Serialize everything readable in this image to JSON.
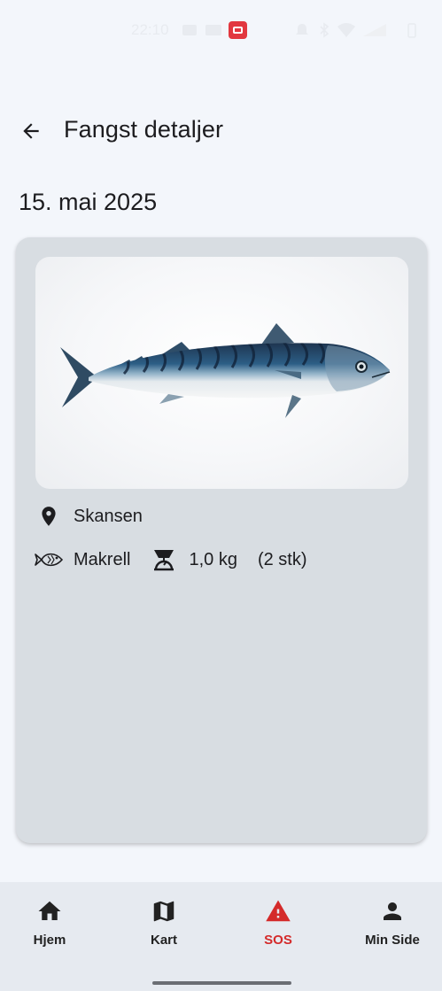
{
  "status_bar": {
    "time": "22:10"
  },
  "header": {
    "title": "Fangst detaljer"
  },
  "catch": {
    "date": "15. mai 2025",
    "location": "Skansen",
    "species": "Makrell",
    "weight": "1,0 kg",
    "count": "(2 stk)"
  },
  "bottom_nav": {
    "items": [
      {
        "label": "Hjem",
        "icon": "home-icon"
      },
      {
        "label": "Kart",
        "icon": "map-icon"
      },
      {
        "label": "SOS",
        "icon": "warning-icon",
        "active": true
      },
      {
        "label": "Min Side",
        "icon": "person-icon"
      }
    ]
  },
  "colors": {
    "background": "#f3f6fb",
    "card": "#d8dde2",
    "nav_background": "#e6eaf0",
    "sos_accent": "#d42a2a"
  }
}
